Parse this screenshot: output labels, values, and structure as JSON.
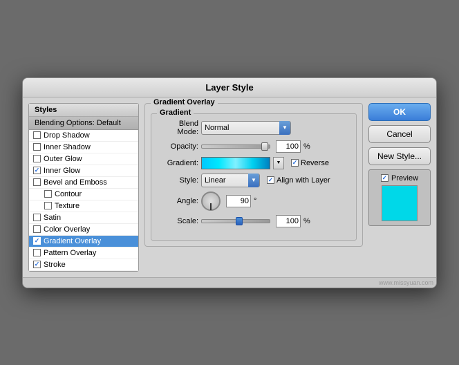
{
  "dialog": {
    "title": "Layer Style"
  },
  "left_panel": {
    "styles_label": "Styles",
    "blending_label": "Blending Options: Default",
    "items": [
      {
        "label": "Drop Shadow",
        "checked": false,
        "sub": false
      },
      {
        "label": "Inner Shadow",
        "checked": false,
        "sub": false
      },
      {
        "label": "Outer Glow",
        "checked": false,
        "sub": false
      },
      {
        "label": "Inner Glow",
        "checked": true,
        "sub": false
      },
      {
        "label": "Bevel and Emboss",
        "checked": false,
        "sub": false
      },
      {
        "label": "Contour",
        "checked": false,
        "sub": true
      },
      {
        "label": "Texture",
        "checked": false,
        "sub": true
      },
      {
        "label": "Satin",
        "checked": false,
        "sub": false
      },
      {
        "label": "Color Overlay",
        "checked": false,
        "sub": false
      },
      {
        "label": "Gradient Overlay",
        "checked": true,
        "sub": false,
        "active": true
      },
      {
        "label": "Pattern Overlay",
        "checked": false,
        "sub": false
      },
      {
        "label": "Stroke",
        "checked": true,
        "sub": false
      }
    ]
  },
  "center": {
    "group_label": "Gradient Overlay",
    "inner_label": "Gradient",
    "blend_mode_label": "Blend Mode:",
    "blend_mode_value": "Normal",
    "opacity_label": "Opacity:",
    "opacity_value": "100",
    "opacity_unit": "%",
    "gradient_label": "Gradient:",
    "reverse_label": "Reverse",
    "reverse_checked": true,
    "style_label": "Style:",
    "style_value": "Linear",
    "align_label": "Align with Layer",
    "align_checked": true,
    "angle_label": "Angle:",
    "angle_value": "90",
    "angle_unit": "°",
    "scale_label": "Scale:",
    "scale_value": "100",
    "scale_unit": "%"
  },
  "right_panel": {
    "ok_label": "OK",
    "cancel_label": "Cancel",
    "new_style_label": "New Style...",
    "preview_label": "Preview",
    "preview_checked": true
  },
  "watermark": "www.missyuan.com"
}
